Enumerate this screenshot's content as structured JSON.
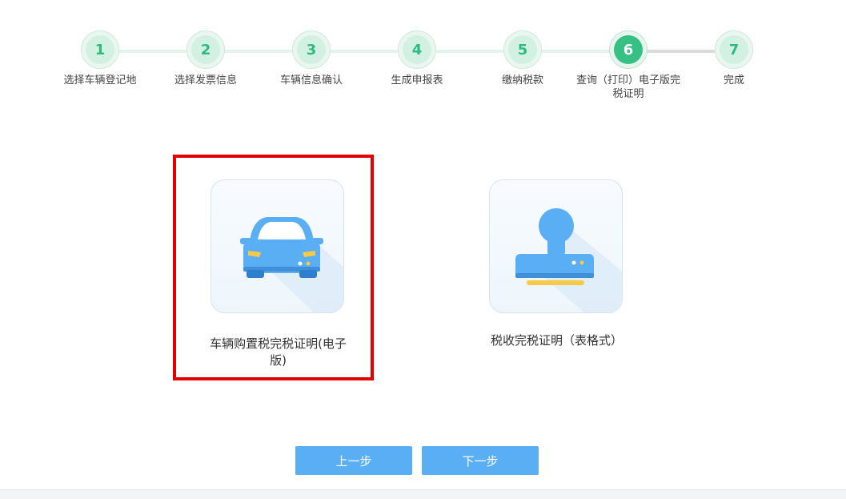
{
  "steps": [
    {
      "num": "1",
      "label": "选择车辆登记地"
    },
    {
      "num": "2",
      "label": "选择发票信息"
    },
    {
      "num": "3",
      "label": "车辆信息确认"
    },
    {
      "num": "4",
      "label": "生成申报表"
    },
    {
      "num": "5",
      "label": "缴纳税款"
    },
    {
      "num": "6",
      "label": "查询（打印）电子版完税证明"
    },
    {
      "num": "7",
      "label": "完成"
    }
  ],
  "current_step": 6,
  "options": [
    {
      "label": "车辆购置税完税证明(电子版)",
      "icon": "car-icon",
      "selected": true
    },
    {
      "label": "税收完税证明（表格式）",
      "icon": "stamp-icon",
      "selected": false
    }
  ],
  "buttons": {
    "prev": "上一步",
    "next": "下一步"
  },
  "colors": {
    "step_active": "#36c084",
    "step_number": "#2fba7e",
    "button": "#5aaef3",
    "selection_frame": "#e00000",
    "icon_blue": "#5aaef3"
  }
}
